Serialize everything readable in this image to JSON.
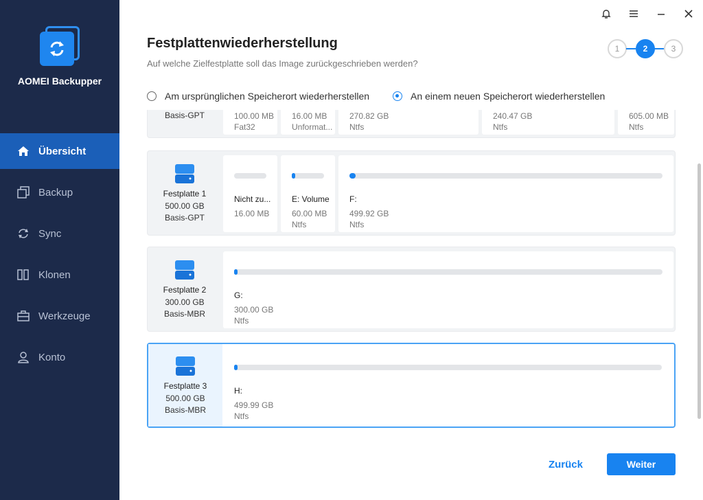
{
  "app": {
    "name": "AOMEI Backupper"
  },
  "sidebar": {
    "items": [
      {
        "label": "Übersicht",
        "icon": "home-icon",
        "active": true
      },
      {
        "label": "Backup",
        "icon": "backup-icon"
      },
      {
        "label": "Sync",
        "icon": "sync-icon"
      },
      {
        "label": "Klonen",
        "icon": "clone-icon"
      },
      {
        "label": "Werkzeuge",
        "icon": "tools-icon"
      },
      {
        "label": "Konto",
        "icon": "user-icon"
      }
    ]
  },
  "window_controls": [
    "bell-icon",
    "menu-icon",
    "minimize-icon",
    "close-icon"
  ],
  "header": {
    "title": "Festplattenwiederherstellung",
    "subtitle": "Auf welche Zielfestplatte soll das Image zurückgeschrieben werden?"
  },
  "steps": [
    {
      "label": "1"
    },
    {
      "label": "2",
      "active": true
    },
    {
      "label": "3"
    }
  ],
  "options": {
    "original": "Am ursprünglichen Speicherort wiederherstellen",
    "new": "An einem neuen Speicherort wiederherstellen",
    "selected": "new"
  },
  "disks": [
    {
      "name": "",
      "size": "",
      "type": "Basis-GPT",
      "partitions": [
        {
          "label": "",
          "size": "100.00 MB",
          "fs": "Fat32",
          "fill": 0
        },
        {
          "label": "",
          "size": "16.00 MB",
          "fs": "Unformat...",
          "fill": 0
        },
        {
          "label": "",
          "size": "270.82 GB",
          "fs": "Ntfs",
          "fill": 0
        },
        {
          "label": "",
          "size": "240.47 GB",
          "fs": "Ntfs",
          "fill": 0
        },
        {
          "label": "",
          "size": "605.00 MB",
          "fs": "Ntfs",
          "fill": 0
        }
      ]
    },
    {
      "name": "Festplatte 1",
      "size": "500.00 GB",
      "type": "Basis-GPT",
      "partitions": [
        {
          "label": "Nicht zu...",
          "size": "16.00 MB",
          "fs": "",
          "fill": 0
        },
        {
          "label": "E: Volume",
          "size": "60.00 MB",
          "fs": "Ntfs",
          "fill": 0.05
        },
        {
          "label": "F:",
          "size": "499.92 GB",
          "fs": "Ntfs",
          "fill": 0.02
        }
      ]
    },
    {
      "name": "Festplatte 2",
      "size": "300.00 GB",
      "type": "Basis-MBR",
      "partitions": [
        {
          "label": "G:",
          "size": "300.00 GB",
          "fs": "Ntfs",
          "fill": 0.005
        }
      ]
    },
    {
      "name": "Festplatte 3",
      "size": "500.00 GB",
      "type": "Basis-MBR",
      "selected": true,
      "partitions": [
        {
          "label": "H:",
          "size": "499.99 GB",
          "fs": "Ntfs",
          "fill": 0.005
        }
      ]
    }
  ],
  "buttons": {
    "back": "Zurück",
    "next": "Weiter"
  },
  "colors": {
    "sidebar": "#1c2a4a",
    "active_nav": "#1b5fb8",
    "accent": "#1883f0"
  }
}
